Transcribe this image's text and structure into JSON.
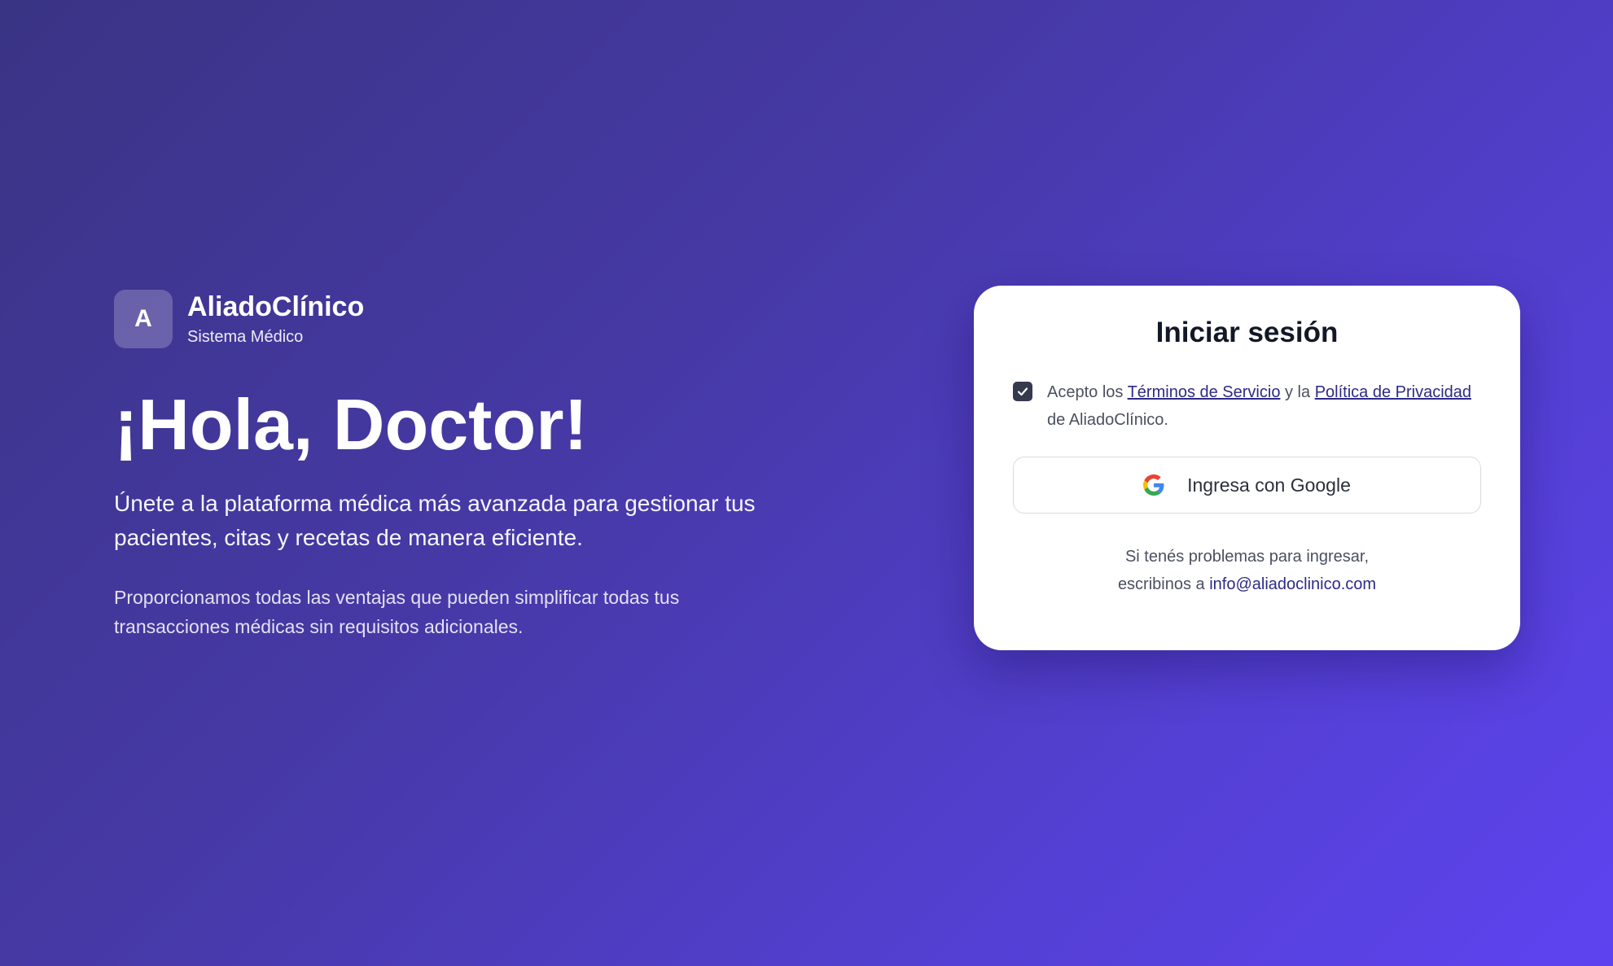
{
  "brand": {
    "logo_letter": "A",
    "name": "AliadoClínico",
    "subtitle": "Sistema Médico"
  },
  "hero": {
    "headline": "¡Hola, Doctor!",
    "lead": "Únete a la plataforma médica más avanzada para gestionar tus pacientes, citas y recetas de manera eficiente.",
    "description": "Proporcionamos todas las ventajas que pueden simplificar todas tus transacciones médicas sin requisitos adicionales."
  },
  "login_card": {
    "title": "Iniciar sesión",
    "terms": {
      "checked": true,
      "prefix": "Acepto los",
      "terms_link": "Términos de Servicio",
      "middle": "y la",
      "privacy_link": "Política de Privacidad",
      "suffix": "de AliadoClínico."
    },
    "google_button_label": "Ingresa con Google",
    "help_line1": "Si tenés problemas para ingresar,",
    "help_prefix": "escribinos a",
    "help_email": "info@aliadoclinico.com"
  },
  "colors": {
    "accent": "#5d43f0",
    "link": "#2e2a86",
    "checkbox": "#363a4d"
  },
  "icons": {
    "google": "google-g-icon",
    "check": "check-icon"
  }
}
